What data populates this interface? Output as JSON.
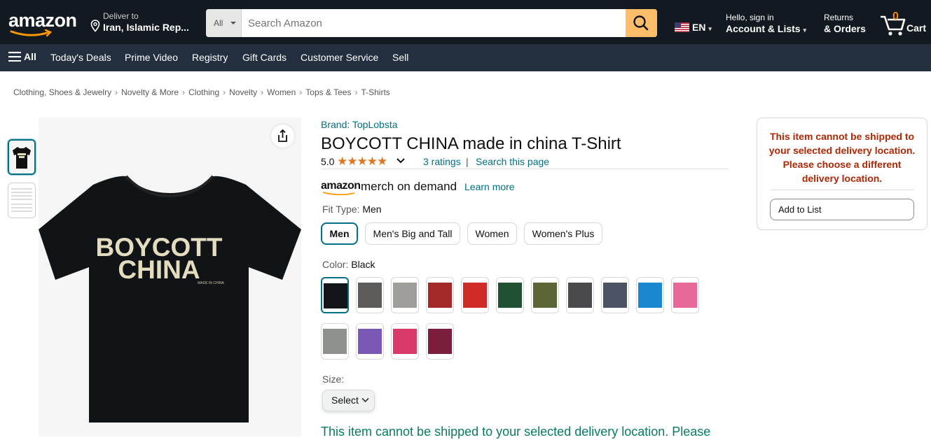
{
  "header": {
    "logo": "amazon",
    "deliver_line1": "Deliver to",
    "deliver_line2": "Iran, Islamic Rep...",
    "search_category": "All",
    "search_placeholder": "Search Amazon",
    "language": "EN",
    "account_line1": "Hello, sign in",
    "account_line2": "Account & Lists",
    "returns_line1": "Returns",
    "returns_line2": "& Orders",
    "cart_count": "0",
    "cart_label": "Cart"
  },
  "subnav": {
    "all": "All",
    "items": [
      "Today's Deals",
      "Prime Video",
      "Registry",
      "Gift Cards",
      "Customer Service",
      "Sell"
    ]
  },
  "breadcrumb": [
    "Clothing, Shoes & Jewelry",
    "Novelty & More",
    "Clothing",
    "Novelty",
    "Women",
    "Tops & Tees",
    "T-Shirts"
  ],
  "product": {
    "brand": "Brand: TopLobsta",
    "title": "BOYCOTT CHINA made in china T-Shirt",
    "rating_value": "5.0",
    "stars": "★★★★★",
    "ratings_count": "3 ratings",
    "pipe": "|",
    "search_page": "Search this page",
    "merch_amazon": "amazon",
    "merch_name": "merch on demand",
    "learn_more": "Learn more",
    "shirt_text_line1": "BOYCOTT",
    "shirt_text_line2": "CHINA",
    "shirt_small_text": "MADE IN CHINA"
  },
  "fit_type": {
    "label": "Fit Type:",
    "value": "Men",
    "options": [
      "Men",
      "Men's Big and Tall",
      "Women",
      "Women's Plus"
    ]
  },
  "color": {
    "label": "Color:",
    "value": "Black",
    "swatches": [
      "#111418",
      "#5d5c5a",
      "#a09e9b",
      "#a42a2a",
      "#cf2c27",
      "#1f5132",
      "#5b6535",
      "#4a4a4d",
      "#4c5464",
      "#1a88d0",
      "#e6699a",
      "#8e918d",
      "#7a58b4",
      "#d83a6a",
      "#7a1e3b"
    ]
  },
  "size": {
    "label": "Size:",
    "select": "Select"
  },
  "shipping_message": "This item cannot be shipped to your selected delivery location. Please",
  "buybox": {
    "warning": "This item cannot be shipped to your selected delivery location. Please choose a different delivery location.",
    "add_to_list": "Add to List"
  },
  "colors": {
    "header_bg": "#131921",
    "subnav_bg": "#232f3e",
    "search_button": "#febd69",
    "link": "#007185",
    "star": "#de7921",
    "warning": "#b12704",
    "success": "#067d62"
  }
}
